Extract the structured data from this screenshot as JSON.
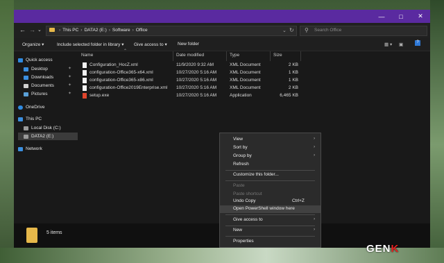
{
  "breadcrumbs": [
    "This PC",
    "DATA2 (E:)",
    "Software",
    "Office"
  ],
  "search_placeholder": "Search Office",
  "commands": [
    "Organize",
    "Include selected folder in library",
    "Give access to",
    "New folder"
  ],
  "columns": [
    "Name",
    "Date modified",
    "Type",
    "Size"
  ],
  "files": [
    {
      "name": "Configuration_HocZ.xml",
      "date": "11/9/2020 9:32 AM",
      "type": "XML Document",
      "size": "2 KB"
    },
    {
      "name": "configuration-Office365-x64.xml",
      "date": "10/27/2020 5:16 AM",
      "type": "XML Document",
      "size": "1 KB"
    },
    {
      "name": "configuration-Office365-x86.xml",
      "date": "10/27/2020 5:16 AM",
      "type": "XML Document",
      "size": "1 KB"
    },
    {
      "name": "configuration-Office2019Enterprise.xml",
      "date": "10/27/2020 5:16 AM",
      "type": "XML Document",
      "size": "2 KB"
    },
    {
      "name": "setup.exe",
      "date": "10/27/2020 5:16 AM",
      "type": "Application",
      "size": "6,465 KB"
    }
  ],
  "sidebar": {
    "quick_access": "Quick access",
    "quick_items": [
      "Desktop",
      "Downloads",
      "Documents",
      "Pictures"
    ],
    "onedrive": "OneDrive",
    "this_pc": "This PC",
    "drives": [
      "Local Disk (C:)",
      "DATA2 (E:)"
    ],
    "network": "Network"
  },
  "status": {
    "items": "5 items"
  },
  "context_menu": {
    "view": "View",
    "sort_by": "Sort by",
    "group_by": "Group by",
    "refresh": "Refresh",
    "customize": "Customize this folder...",
    "paste": "Paste",
    "paste_shortcut": "Paste shortcut",
    "undo_copy": "Undo Copy",
    "undo_shortcut": "Ctrl+Z",
    "open_powershell": "Open PowerShell window here",
    "give_access": "Give access to",
    "new": "New",
    "properties": "Properties"
  },
  "watermark": {
    "left": "GEN",
    "right": "K"
  },
  "colors": {
    "titlebar": "#5a2aa0",
    "window_bg": "#191919",
    "folder": "#e6b84a",
    "menu_bg": "#2b2b2b"
  }
}
